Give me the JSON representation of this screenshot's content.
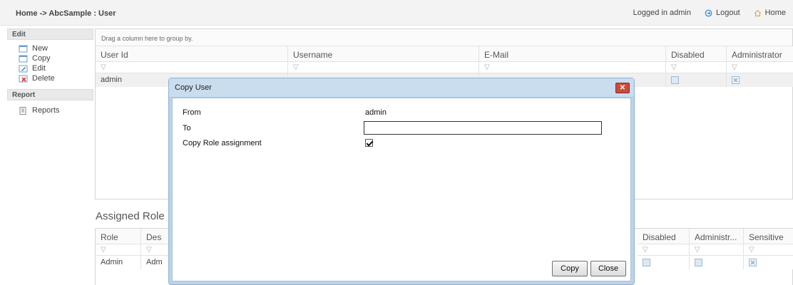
{
  "header": {
    "breadcrumb": "Home -> AbcSample : User",
    "logged_in": "Logged in admin",
    "logout_label": "Logout",
    "home_label": "Home"
  },
  "sidebar": {
    "edit_heading": "Edit",
    "items": [
      {
        "label": "New",
        "icon": "new-icon"
      },
      {
        "label": "Copy",
        "icon": "copy-icon"
      },
      {
        "label": "Edit",
        "icon": "edit-icon"
      },
      {
        "label": "Delete",
        "icon": "delete-icon"
      }
    ],
    "report_heading": "Report",
    "report_items": [
      {
        "label": "Reports",
        "icon": "reports-icon"
      }
    ]
  },
  "users_grid": {
    "group_hint": "Drag a column here to group by.",
    "columns": [
      "User Id",
      "Username",
      "E-Mail",
      "Disabled",
      "Administrator"
    ],
    "filter_icon": "filter-icon",
    "rows": [
      {
        "user_id": "admin",
        "username": "",
        "email": "",
        "disabled": false,
        "administrator": true
      }
    ]
  },
  "roles_section": {
    "title": "Assigned Role",
    "columns": [
      "Role",
      "Des",
      "Disabled",
      "Administr...",
      "Sensitive"
    ],
    "rows": [
      {
        "role": "Admin",
        "description": "Adm",
        "disabled": false,
        "administrator": false,
        "sensitive": true
      }
    ]
  },
  "dialog": {
    "title": "Copy User",
    "from_label": "From",
    "from_value": "admin",
    "to_label": "To",
    "to_value": "",
    "copy_role_label": "Copy Role assignment",
    "copy_role_checked": true,
    "copy_button": "Copy",
    "close_button": "Close"
  },
  "colors": {
    "dialog_frame": "#bcd3ea",
    "close_button": "#c94b3c",
    "checkbox_fill": "#dbe9f5"
  }
}
